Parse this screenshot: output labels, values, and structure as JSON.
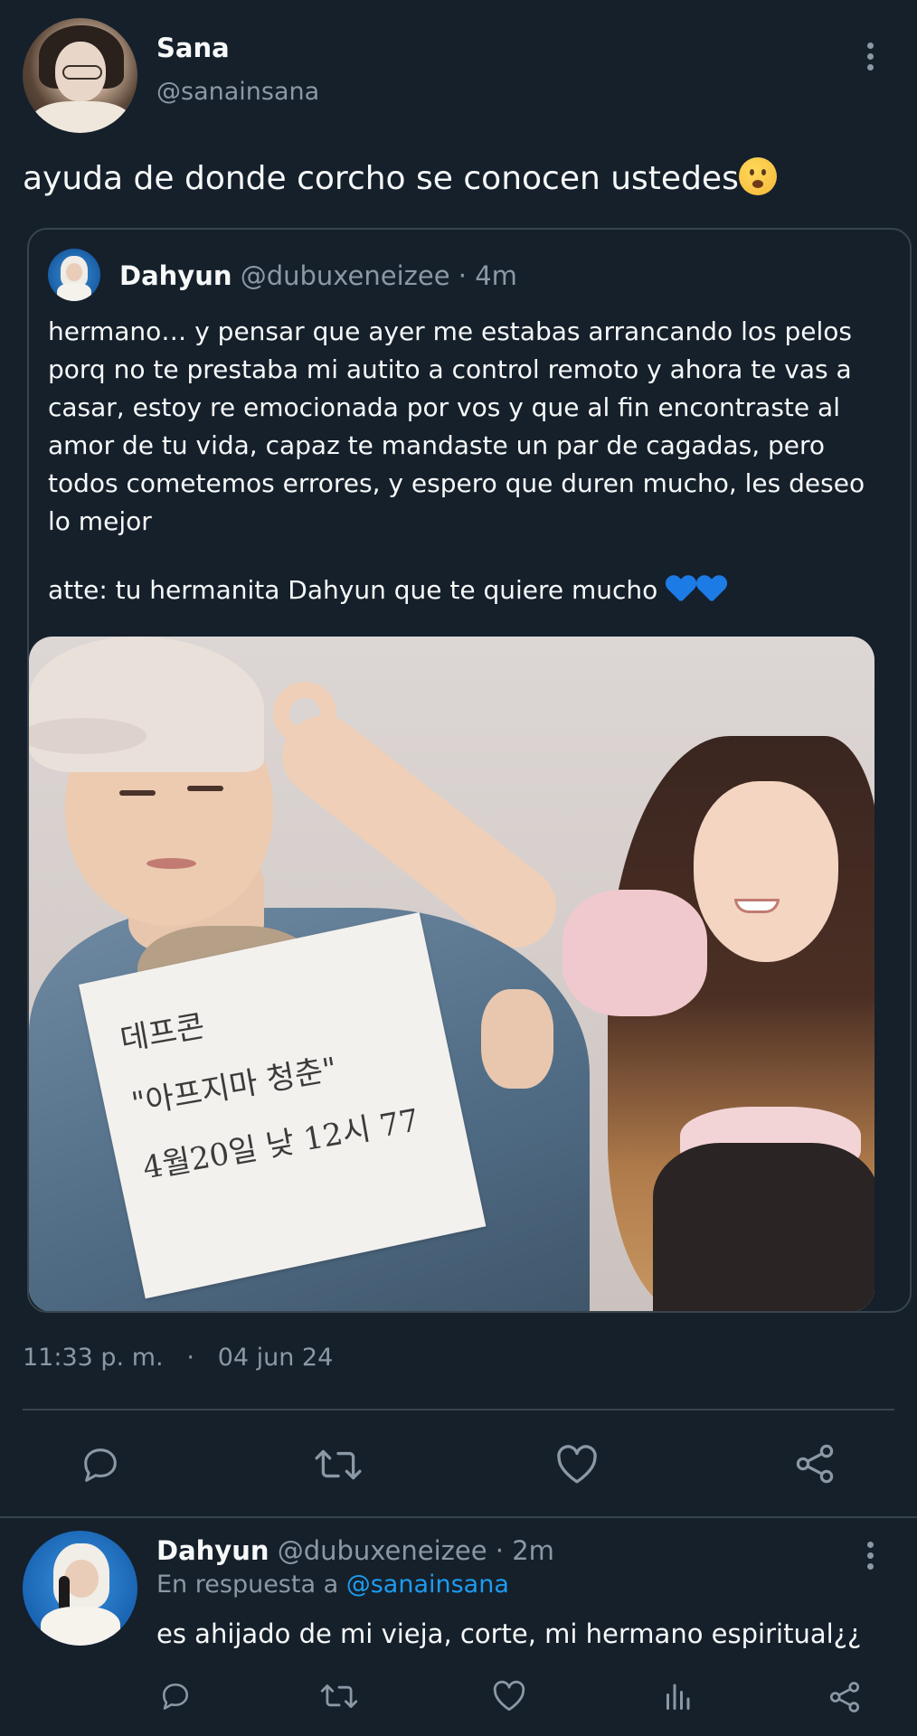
{
  "main_tweet": {
    "author_name": "Sana",
    "author_handle": "@sanainsana",
    "text": "ayuda de donde corcho se conocen ustedes",
    "emoji": "worried-face-emoji",
    "time": "11:33 p. m.",
    "separator": "·",
    "date": "04 jun 24"
  },
  "quoted_tweet": {
    "author_name": "Dahyun",
    "author_handle": "@dubuxeneizee",
    "age": "· 4m",
    "text": "hermano… y pensar que ayer me estabas arrancando los pelos porq no te prestaba mi autito a control remoto y ahora te vas a casar, estoy re emocionada por vos y que al fin encontraste al amor de tu vida, capaz te mandaste un par de cagadas, pero todos cometemos errores, y espero que duren mucho, les deseo lo mejor",
    "signature": "atte: tu hermanita Dahyun que te quiere mucho",
    "signature_emoji": "blue-heart-emoji",
    "photo_sign_lines": [
      "데프콘",
      "\"아프지마 청춘\"",
      "4월20일 낮 12시 77"
    ]
  },
  "reply": {
    "author_name": "Dahyun",
    "author_handle": "@dubuxeneizee",
    "age": "· 2m",
    "reply_prefix": "En respuesta a",
    "reply_target": "@sanainsana",
    "text": "es ahijado de mi vieja, corte, mi hermano espiritual¿¿"
  },
  "icons": {
    "reply": "reply-icon",
    "retweet": "retweet-icon",
    "like": "heart-icon",
    "views": "views-icon",
    "share": "share-icon",
    "more": "more-icon"
  },
  "colors": {
    "background": "#15202b",
    "text": "#f7f9f9",
    "secondary": "#8b98a5",
    "border": "#38444d",
    "link": "#1d9bf0"
  }
}
